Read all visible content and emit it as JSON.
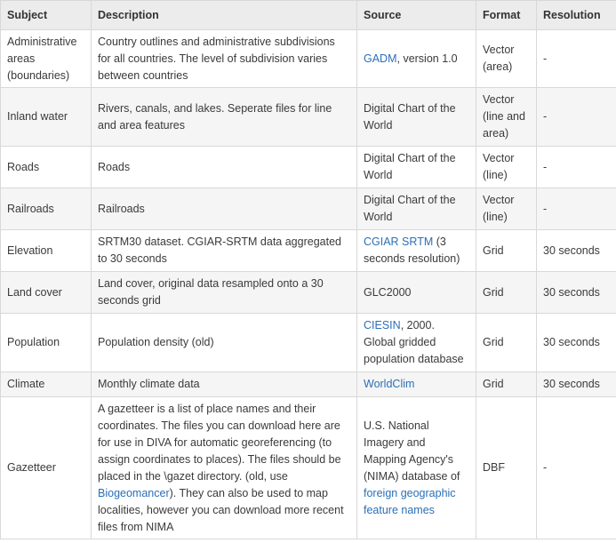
{
  "headers": {
    "subject": "Subject",
    "description": "Description",
    "source": "Source",
    "format": "Format",
    "resolution": "Resolution"
  },
  "rows": [
    {
      "subject": "Administrative areas (boundaries)",
      "description": "Country outlines and administrative subdivisions for all countries. The level of subdivision varies between countries",
      "source_link": "GADM",
      "source_after": ", version 1.0",
      "format": "Vector (area)",
      "resolution": "-"
    },
    {
      "subject": "Inland water",
      "description": "Rivers, canals, and lakes. Seperate files for line and area features",
      "source": "Digital Chart of the World",
      "format": "Vector (line and area)",
      "resolution": "-"
    },
    {
      "subject": "Roads",
      "description": "Roads",
      "source": "Digital Chart of the World",
      "format": "Vector (line)",
      "resolution": "-"
    },
    {
      "subject": "Railroads",
      "description": "Railroads",
      "source": "Digital Chart of the World",
      "format": "Vector (line)",
      "resolution": "-"
    },
    {
      "subject": "Elevation",
      "description": "SRTM30 dataset. CGIAR-SRTM data aggregated to 30 seconds",
      "source_link": "CGIAR SRTM",
      "source_after": " (3 seconds resolution)",
      "format": "Grid",
      "resolution": "30 seconds"
    },
    {
      "subject": "Land cover",
      "description": "Land cover, original data resampled onto a 30 seconds grid",
      "source": "GLC2000",
      "format": "Grid",
      "resolution": "30 seconds"
    },
    {
      "subject": "Population",
      "description": "Population density (old)",
      "source_link": "CIESIN",
      "source_after": ", 2000. Global gridded population database",
      "format": "Grid",
      "resolution": "30 seconds"
    },
    {
      "subject": "Climate",
      "description": "Monthly climate data",
      "source_link": "WorldClim",
      "format": "Grid",
      "resolution": "30 seconds"
    },
    {
      "subject": "Gazetteer",
      "description_before": "A gazetteer is a list of place names and their coordinates. The files you can download here are for use in DIVA for automatic georeferencing (to assign coordinates to places). The files should be placed in the \\gazet directory. (old, use ",
      "description_link": "Biogeomancer",
      "description_after": "). They can also be used to map localities, however you can download more recent files from NIMA",
      "source_before": "U.S. National Imagery and Mapping Agency's (NIMA) database of ",
      "source_link": "foreign geographic feature names",
      "format": "DBF",
      "resolution": "-"
    }
  ]
}
